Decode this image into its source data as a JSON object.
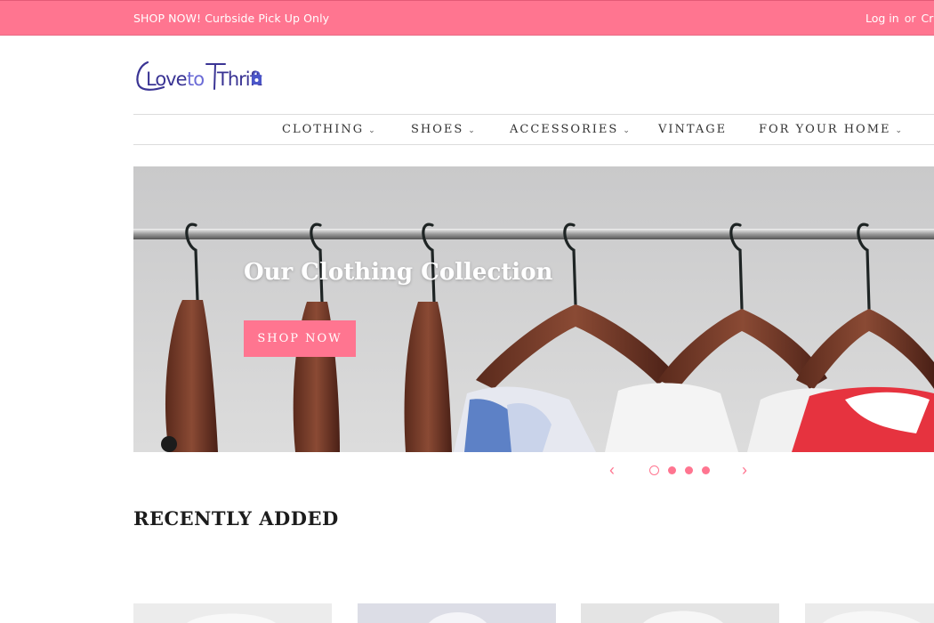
{
  "announcement": {
    "text": "SHOP NOW! Curbside Pick Up Only",
    "login": "Log in",
    "separator": "or",
    "create": "Cr"
  },
  "logo": {
    "text_love": "Love",
    "text_to": "to",
    "text_thrift": "Thrift",
    "colors": {
      "love": "#3a3494",
      "to": "#6b6bd6",
      "thrift": "#3a3494",
      "bag": "#4b56c9"
    }
  },
  "nav": {
    "items": [
      {
        "label": "CLOTHING",
        "has_dropdown": true
      },
      {
        "label": "SHOES",
        "has_dropdown": true
      },
      {
        "label": "ACCESSORIES",
        "has_dropdown": true
      },
      {
        "label": "VINTAGE",
        "has_dropdown": false
      },
      {
        "label": "FOR YOUR HOME",
        "has_dropdown": true
      }
    ],
    "chevron": "⌄"
  },
  "hero": {
    "title": "Our Clothing Collection",
    "button_label": "SHOP NOW"
  },
  "slider": {
    "prev": "‹",
    "next": "›",
    "slide_count": 4,
    "active_slide": 1
  },
  "recently_added": {
    "title": "RECENTLY ADDED",
    "product_count_visible": 4
  },
  "colors": {
    "accent": "#ff7590",
    "text": "#222222",
    "rule": "#dcdcdc"
  }
}
